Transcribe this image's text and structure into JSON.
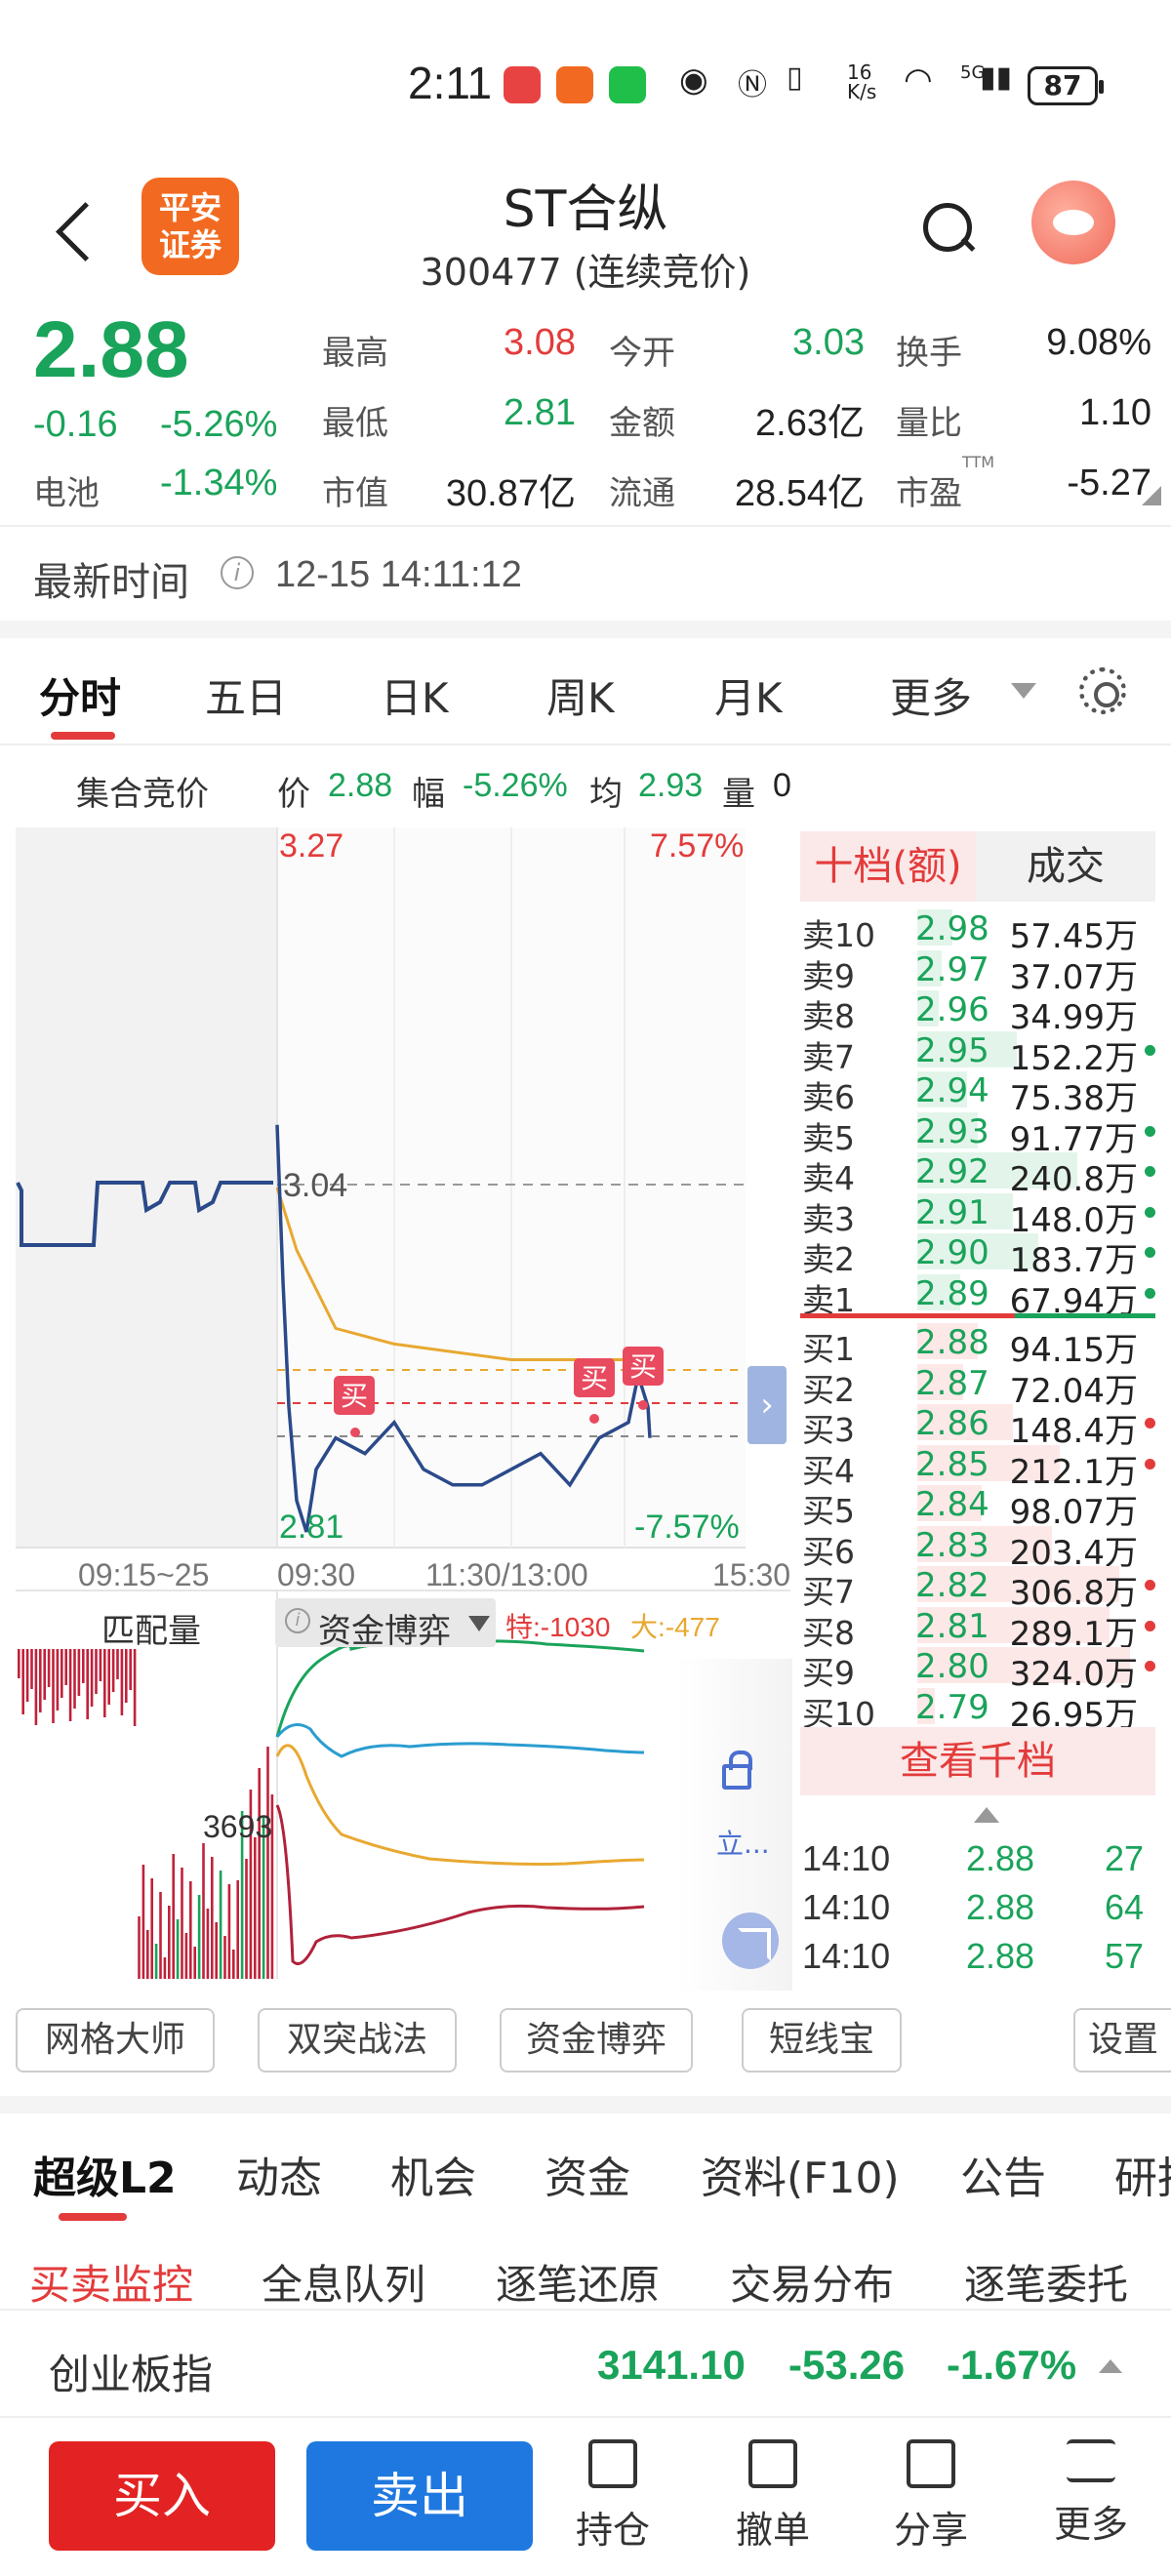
{
  "status_bar": {
    "time": "2:11",
    "network_speed": "16\nK/s",
    "signal": "5G",
    "battery": "87",
    "app_icons": [
      "huawei-icon",
      "pingan-icon",
      "wechat-icon"
    ]
  },
  "header": {
    "broker_logo": "平安\n证券",
    "stock_name": "ST合纵",
    "stock_code": "300477 (连续竞价)"
  },
  "quote": {
    "price": "2.88",
    "change": "-0.16",
    "change_pct": "-5.26%",
    "sector_label": "电池",
    "sector_pct": "-1.34%",
    "high_label": "最高",
    "high": "3.08",
    "low_label": "最低",
    "low": "2.81",
    "open_label": "今开",
    "open": "3.03",
    "amount_label": "金额",
    "amount": "2.63亿",
    "turnover_label": "换手",
    "turnover": "9.08%",
    "vol_ratio_label": "量比",
    "vol_ratio": "1.10",
    "mktcap_label": "市值",
    "mktcap": "30.87亿",
    "float_label": "流通",
    "float_cap": "28.54亿",
    "pe_label": "市盈",
    "pe_sup": "TTM",
    "pe": "-5.27"
  },
  "latest_time": {
    "label": "最新时间",
    "value": "12-15 14:11:12"
  },
  "chart_tabs": [
    "分时",
    "五日",
    "日K",
    "周K",
    "月K",
    "更多"
  ],
  "auction_summary": {
    "title": "集合竞价",
    "price_label": "价",
    "price": "2.88",
    "range_label": "幅",
    "range": "-5.26%",
    "avg_label": "均",
    "avg": "2.93",
    "volume_label": "量",
    "volume": "0"
  },
  "chart_labels": {
    "top_price": "3.27",
    "top_pct": "7.57%",
    "bottom_price": "2.81",
    "bottom_pct": "-7.57%",
    "mid_price": "3.04",
    "buy_marker": "买",
    "x_ticks": [
      "09:15~25",
      "09:30",
      "11:30/13:00",
      "15:30"
    ]
  },
  "chart_data": {
    "type": "line",
    "title": "",
    "ylim": [
      2.81,
      3.27
    ],
    "pre_close": 3.04,
    "series": [
      {
        "name": "",
        "x": [
          "09:30",
          "09:33",
          "09:36",
          "09:40",
          "09:45",
          "09:50",
          "10:00",
          "10:15",
          "10:30",
          "10:45",
          "11:00",
          "11:15",
          "11:30",
          "13:15",
          "13:30",
          "13:45",
          "14:00",
          "14:05",
          "14:10",
          "14:11"
        ],
        "values": [
          3.08,
          2.98,
          2.9,
          2.84,
          2.82,
          2.86,
          2.88,
          2.87,
          2.89,
          2.86,
          2.85,
          2.85,
          2.86,
          2.87,
          2.85,
          2.88,
          2.89,
          2.92,
          2.9,
          2.88
        ]
      },
      {
        "name": "",
        "x": [
          "09:30",
          "09:40",
          "10:00",
          "10:30",
          "11:30",
          "13:30",
          "14:11"
        ],
        "values": [
          3.04,
          3.0,
          2.95,
          2.94,
          2.93,
          2.93,
          2.93
        ]
      }
    ]
  },
  "order_book": {
    "tab_left": "十档(额)",
    "tab_right": "成交",
    "asks": [
      {
        "label": "卖10",
        "price": "2.98",
        "vol": "57.45万",
        "bar": 0.1,
        "dot": ""
      },
      {
        "label": "卖9",
        "price": "2.97",
        "vol": "37.07万",
        "bar": 0.07,
        "dot": ""
      },
      {
        "label": "卖8",
        "price": "2.96",
        "vol": "34.99万",
        "bar": 0.06,
        "dot": ""
      },
      {
        "label": "卖7",
        "price": "2.95",
        "vol": "152.2万",
        "bar": 0.28,
        "dot": "#1aa35a"
      },
      {
        "label": "卖6",
        "price": "2.94",
        "vol": "75.38万",
        "bar": 0.14,
        "dot": ""
      },
      {
        "label": "卖5",
        "price": "2.93",
        "vol": "91.77万",
        "bar": 0.17,
        "dot": "#1aa35a"
      },
      {
        "label": "卖4",
        "price": "2.92",
        "vol": "240.8万",
        "bar": 0.45,
        "dot": "#1aa35a"
      },
      {
        "label": "卖3",
        "price": "2.91",
        "vol": "148.0万",
        "bar": 0.27,
        "dot": "#1aa35a"
      },
      {
        "label": "卖2",
        "price": "2.90",
        "vol": "183.7万",
        "bar": 0.34,
        "dot": "#1aa35a"
      },
      {
        "label": "卖1",
        "price": "2.89",
        "vol": "67.94万",
        "bar": 0.12,
        "dot": "#1aa35a"
      }
    ],
    "bids": [
      {
        "label": "买1",
        "price": "2.88",
        "vol": "94.15万",
        "bar": 0.17,
        "dot": ""
      },
      {
        "label": "买2",
        "price": "2.87",
        "vol": "72.04万",
        "bar": 0.13,
        "dot": ""
      },
      {
        "label": "买3",
        "price": "2.86",
        "vol": "148.4万",
        "bar": 0.27,
        "dot": "#e33b3b"
      },
      {
        "label": "买4",
        "price": "2.85",
        "vol": "212.1万",
        "bar": 0.4,
        "dot": "#e33b3b"
      },
      {
        "label": "买5",
        "price": "2.84",
        "vol": "98.07万",
        "bar": 0.18,
        "dot": ""
      },
      {
        "label": "买6",
        "price": "2.83",
        "vol": "203.4万",
        "bar": 0.38,
        "dot": ""
      },
      {
        "label": "买7",
        "price": "2.82",
        "vol": "306.8万",
        "bar": 0.57,
        "dot": "#e33b3b"
      },
      {
        "label": "买8",
        "price": "2.81",
        "vol": "289.1万",
        "bar": 0.54,
        "dot": "#e33b3b"
      },
      {
        "label": "买9",
        "price": "2.80",
        "vol": "324.0万",
        "bar": 0.6,
        "dot": "#e33b3b"
      },
      {
        "label": "买10",
        "price": "2.79",
        "vol": "26.95万",
        "bar": 0.05,
        "dot": ""
      }
    ],
    "depth_button": "查看千档",
    "ticks": [
      {
        "time": "14:10",
        "price": "2.88",
        "vol": "27"
      },
      {
        "time": "14:10",
        "price": "2.88",
        "vol": "64"
      },
      {
        "time": "14:10",
        "price": "2.88",
        "vol": "57"
      }
    ]
  },
  "indicator": {
    "left_label": "匹配量",
    "tab_label": "资金博弈",
    "legend_special": "特:-1030",
    "legend_large": "大:-477",
    "value_label": "3693",
    "lock_label": "立..."
  },
  "tools": [
    "网格大师",
    "双突战法",
    "资金博弈",
    "短线宝",
    "设置"
  ],
  "bottom_tabs": [
    "超级L2",
    "动态",
    "机会",
    "资金",
    "资料(F10)",
    "公告",
    "研报"
  ],
  "sub_tabs": [
    "买卖监控",
    "全息队列",
    "逐笔还原",
    "交易分布",
    "逐笔委托"
  ],
  "index_bar": {
    "name": "创业板指",
    "value": "3141.10",
    "change": "-53.26",
    "change_pct": "-1.67%"
  },
  "actions": {
    "buy": "买入",
    "sell": "卖出",
    "positions": "持仓",
    "cancel": "撤单",
    "share": "分享",
    "more": "更多"
  },
  "colors": {
    "up": "#e33b3b",
    "down": "#1aa35a",
    "avg_line": "#e8a830",
    "price_line": "#2b4a8a",
    "brand": "#f26a21",
    "buy": "#e32323",
    "sell": "#1e78e0"
  }
}
